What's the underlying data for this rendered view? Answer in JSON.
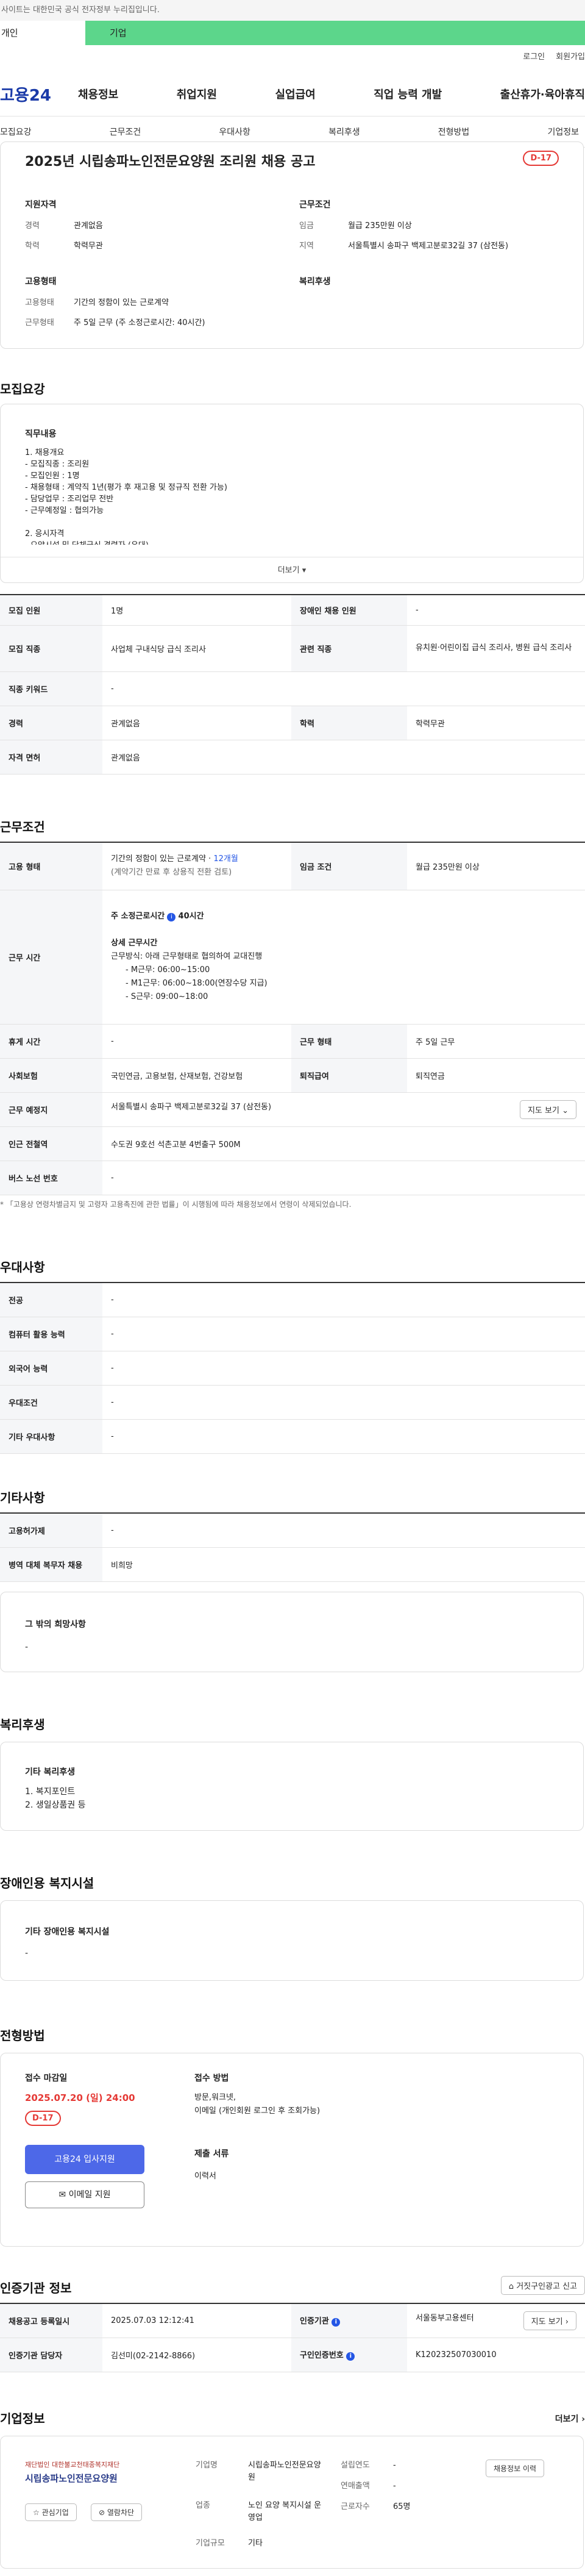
{
  "notice": "사이트는 대한민국 공식 전자정부 누리집입니다.",
  "tabs": {
    "personal": "개인",
    "company": "기업"
  },
  "util": {
    "login": "로그인",
    "join": "회원가입"
  },
  "logo": "고용24",
  "gnb": [
    "채용정보",
    "취업지원",
    "실업급여",
    "직업 능력 개발",
    "출산휴가·육아휴직"
  ],
  "subnav": [
    "모집요강",
    "근무조건",
    "우대사항",
    "복리후생",
    "전형방법",
    "기업정보"
  ],
  "header": {
    "title": "2025년 시립송파노인전문요양원 조리원 채용 공고",
    "dday": "D-17",
    "qual_title": "지원자격",
    "qual": [
      {
        "k": "경력",
        "v": "관계없음"
      },
      {
        "k": "학력",
        "v": "학력무관"
      }
    ],
    "emp_title": "고용형태",
    "emp": [
      {
        "k": "고용형태",
        "v": "기간의 정함이 있는 근로계약"
      },
      {
        "k": "근무형태",
        "v": "주 5일 근무 (주 소정근로시간: 40시간)"
      }
    ],
    "cond_title": "근무조건",
    "cond": [
      {
        "k": "임금",
        "v": "월급 235만원 이상"
      },
      {
        "k": "지역",
        "v": "서울특별시 송파구 백제고분로32길 37 (삼전동)"
      }
    ],
    "welfare_title": "복리후생"
  },
  "recruit": {
    "title": "모집요강",
    "duty_title": "직무내용",
    "duty_lines": [
      "1. 채용개요",
      "- 모집직종 : 조리원",
      "- 모집인원 : 1명",
      "- 채용형태 : 계약직 1년(평가 후 재고용 및 정규직 전환 가능)",
      "- 담당업무 : 조리업무 전반",
      "- 근무예정일 : 협의가능",
      "",
      "2. 응시자격",
      "- 요양시설 및 단체급식 경력자 (우대)"
    ],
    "more": "더보기",
    "rows": [
      {
        "k1": "모집 인원",
        "v1": "1명",
        "k2": "장애인 채용 인원",
        "v2": "-"
      },
      {
        "k1": "모집 직종",
        "v1": "사업체 구내식당 급식 조리사",
        "k2": "관련 직종",
        "v2": "유치원·어린이집 급식 조리사, 병원 급식 조리사"
      },
      {
        "k1": "직종 키워드",
        "v1": "-"
      },
      {
        "k1": "경력",
        "v1": "관계없음",
        "k2": "학력",
        "v2": "학력무관"
      },
      {
        "k1": "자격 면허",
        "v1": "관계없음"
      }
    ]
  },
  "work": {
    "title": "근무조건",
    "emp_k": "고용 형태",
    "emp_v1": "기간의 정함이 있는 근로계약 · ",
    "emp_v1_link": "12개월",
    "emp_v2": "(계약기간 만료 후 상용직 전환 검토)",
    "wage_k": "임금 조건",
    "wage_v": "월급 235만원 이상",
    "time_k": "근무 시간",
    "time_weekly": "주 소정근로시간",
    "time_weekly_v": "40시간",
    "time_detail_title": "상세 근무시간",
    "time_detail": [
      "근무방식: 아래 근무형태로 협의하여 교대진행",
      "- M근무: 06:00~15:00",
      "- M1근무: 06:00~18:00(연장수당 지급)",
      "- S근무: 09:00~18:00"
    ],
    "rest_k": "휴게 시간",
    "rest_v": "-",
    "form_k": "근무 형태",
    "form_v": "주 5일 근무",
    "ins_k": "사회보험",
    "ins_v": "국민연금, 고용보험, 산재보험, 건강보험",
    "ret_k": "퇴직급여",
    "ret_v": "퇴직연금",
    "place_k": "근무 예정지",
    "place_v": "서울특별시 송파구 백제고분로32길 37 (삼전동)",
    "map_btn": "지도 보기",
    "subway_k": "인근 전철역",
    "subway_v": "수도권 9호선 석촌고분 4번출구 500M",
    "bus_k": "버스 노선 번호",
    "bus_v": "-",
    "footnote": "* 「고용상 연령차별금지 및 고령자 고용촉진에 관한 법률」이 시행됨에 따라 채용정보에서 연령이 삭제되었습니다."
  },
  "pref": {
    "title": "우대사항",
    "rows": [
      {
        "k": "전공",
        "v": "-"
      },
      {
        "k": "컴퓨터 활용 능력",
        "v": "-"
      },
      {
        "k": "외국어 능력",
        "v": "-"
      },
      {
        "k": "우대조건",
        "v": "-"
      },
      {
        "k": "기타 우대사항",
        "v": "-"
      }
    ]
  },
  "etc": {
    "title": "기타사항",
    "rows": [
      {
        "k": "고용허가제",
        "v": "-"
      },
      {
        "k": "병역 대체 복무자 채용",
        "v": "비희망"
      }
    ],
    "other_title": "그 밖의 희망사항",
    "other_v": "-"
  },
  "welfare": {
    "title": "복리후생",
    "box_title": "기타 복리후생",
    "items": [
      "1. 복지포인트",
      "2. 생일상품권 등"
    ]
  },
  "disability": {
    "title": "장애인용 복지시설",
    "box_title": "기타 장애인용 복지시설",
    "v": "-"
  },
  "selection": {
    "title": "전형방법",
    "deadline_title": "접수 마감일",
    "deadline": "2025.07.20 (일) 24:00",
    "dday": "D-17",
    "apply_btn": "고용24 입사지원",
    "email_btn": "이메일 지원",
    "method_title": "접수 방법",
    "method_v1": "방문,워크넷,",
    "method_v2": "이메일 (개인회원 로그인 후 조회가능)",
    "docs_title": "제출 서류",
    "docs_v": "이력서"
  },
  "agency": {
    "title": "인증기관 정보",
    "report_btn": "거짓구인광고 신고",
    "rows": [
      {
        "k1": "채용공고 등록일시",
        "v1": "2025.07.03 12:12:41",
        "k2": "인증기관",
        "v2": "서울동부고용센터",
        "btn": "지도 보기"
      },
      {
        "k1": "인증기관 담당자",
        "v1": "김선미(02-2142-8866)",
        "k2": "구인인증번호",
        "v2": "K120232507030010"
      }
    ]
  },
  "company": {
    "title": "기업정보",
    "more": "더보기",
    "logo_line1": "재단법인 대한불교천태종복지재단",
    "logo_line2": "시립송파노인전문요양원",
    "fav_btn": "관심기업",
    "block_btn": "열람차단",
    "k_name": "기업명",
    "v_name": "시립송파노인전문요양원",
    "k_industry": "업종",
    "v_industry": "노인 요양 복지시설 운영업",
    "k_size": "기업규모",
    "v_size": "기타",
    "k_year": "설립연도",
    "v_year": "-",
    "k_sales": "연매출액",
    "v_sales": "-",
    "k_emp": "근로자수",
    "v_emp": "65명",
    "other_jobs": "채용정보 이력"
  }
}
